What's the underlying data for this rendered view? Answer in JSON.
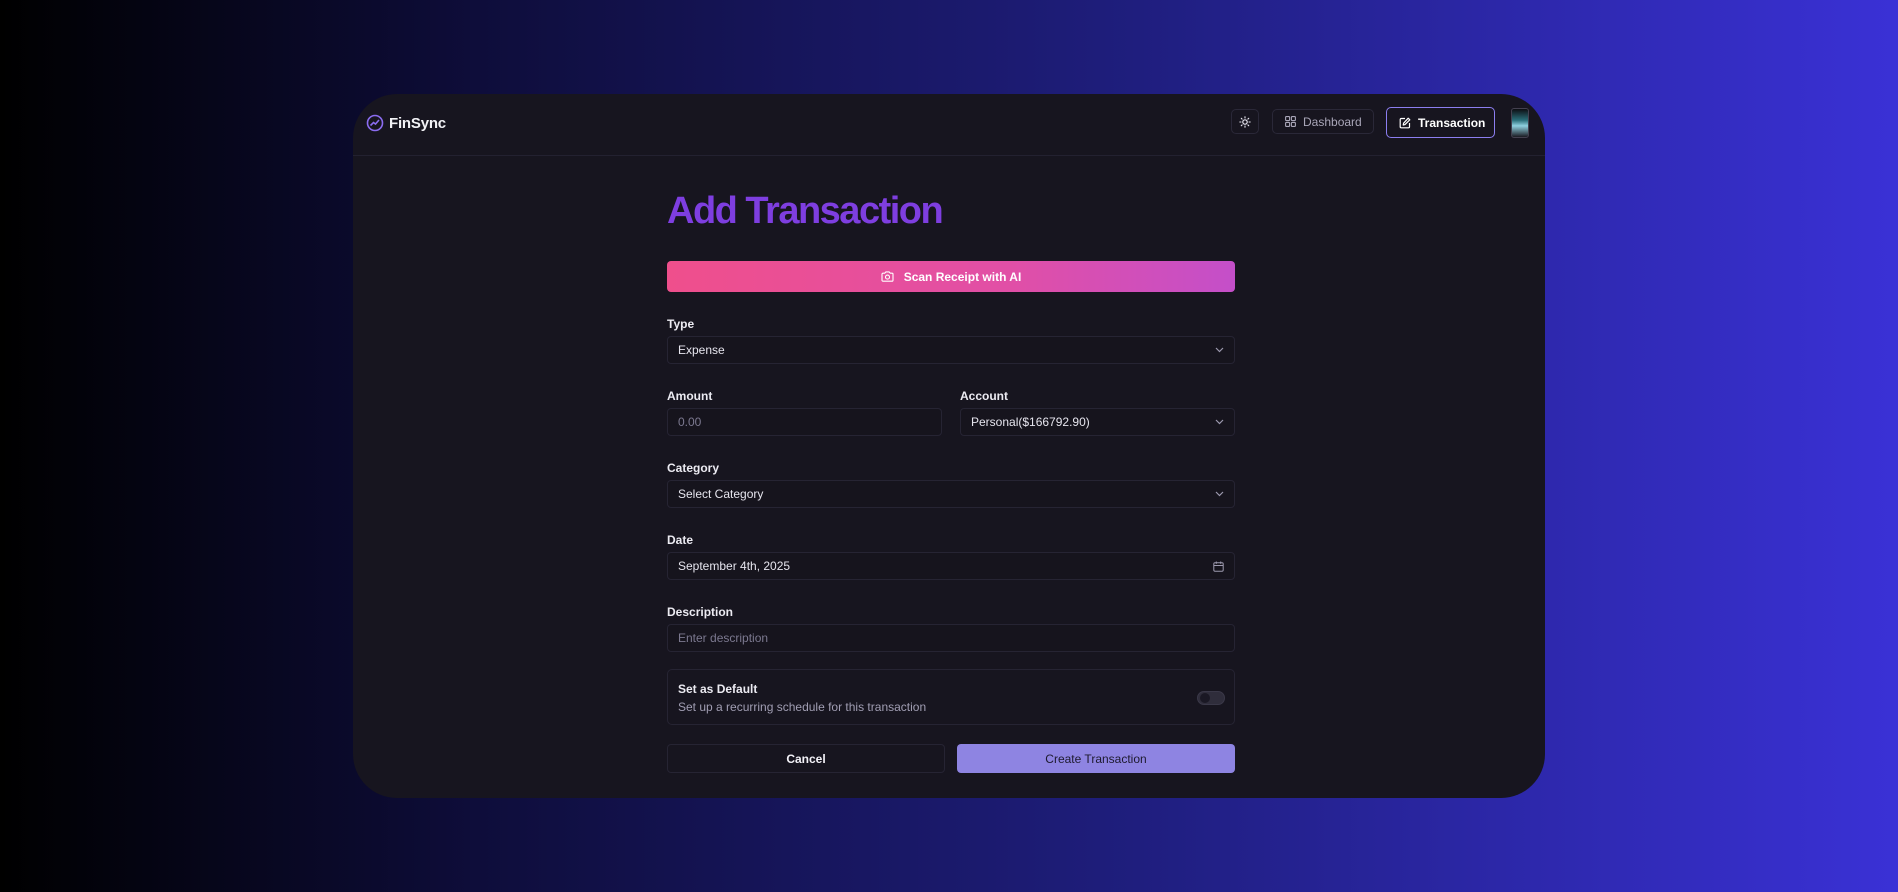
{
  "brand": {
    "name": "FinSync"
  },
  "nav": {
    "dashboard_label": "Dashboard",
    "transaction_label": "Transaction"
  },
  "page": {
    "title": "Add Transaction",
    "scan_label": "Scan Receipt with AI"
  },
  "form": {
    "type": {
      "label": "Type",
      "value": "Expense"
    },
    "amount": {
      "label": "Amount",
      "placeholder": "0.00"
    },
    "account": {
      "label": "Account",
      "value": "Personal($166792.90)"
    },
    "category": {
      "label": "Category",
      "value": "Select Category"
    },
    "date": {
      "label": "Date",
      "value": "September 4th, 2025"
    },
    "description": {
      "label": "Description",
      "placeholder": "Enter description"
    },
    "default": {
      "title": "Set as Default",
      "subtitle": "Set up a recurring schedule for this transaction",
      "enabled": false
    },
    "cancel_label": "Cancel",
    "create_label": "Create Transaction"
  },
  "colors": {
    "accent": "#7e3ee0",
    "primary_button": "#8e84e2",
    "scan_gradient_start": "#ef4f8c",
    "scan_gradient_end": "#c44fc9"
  }
}
